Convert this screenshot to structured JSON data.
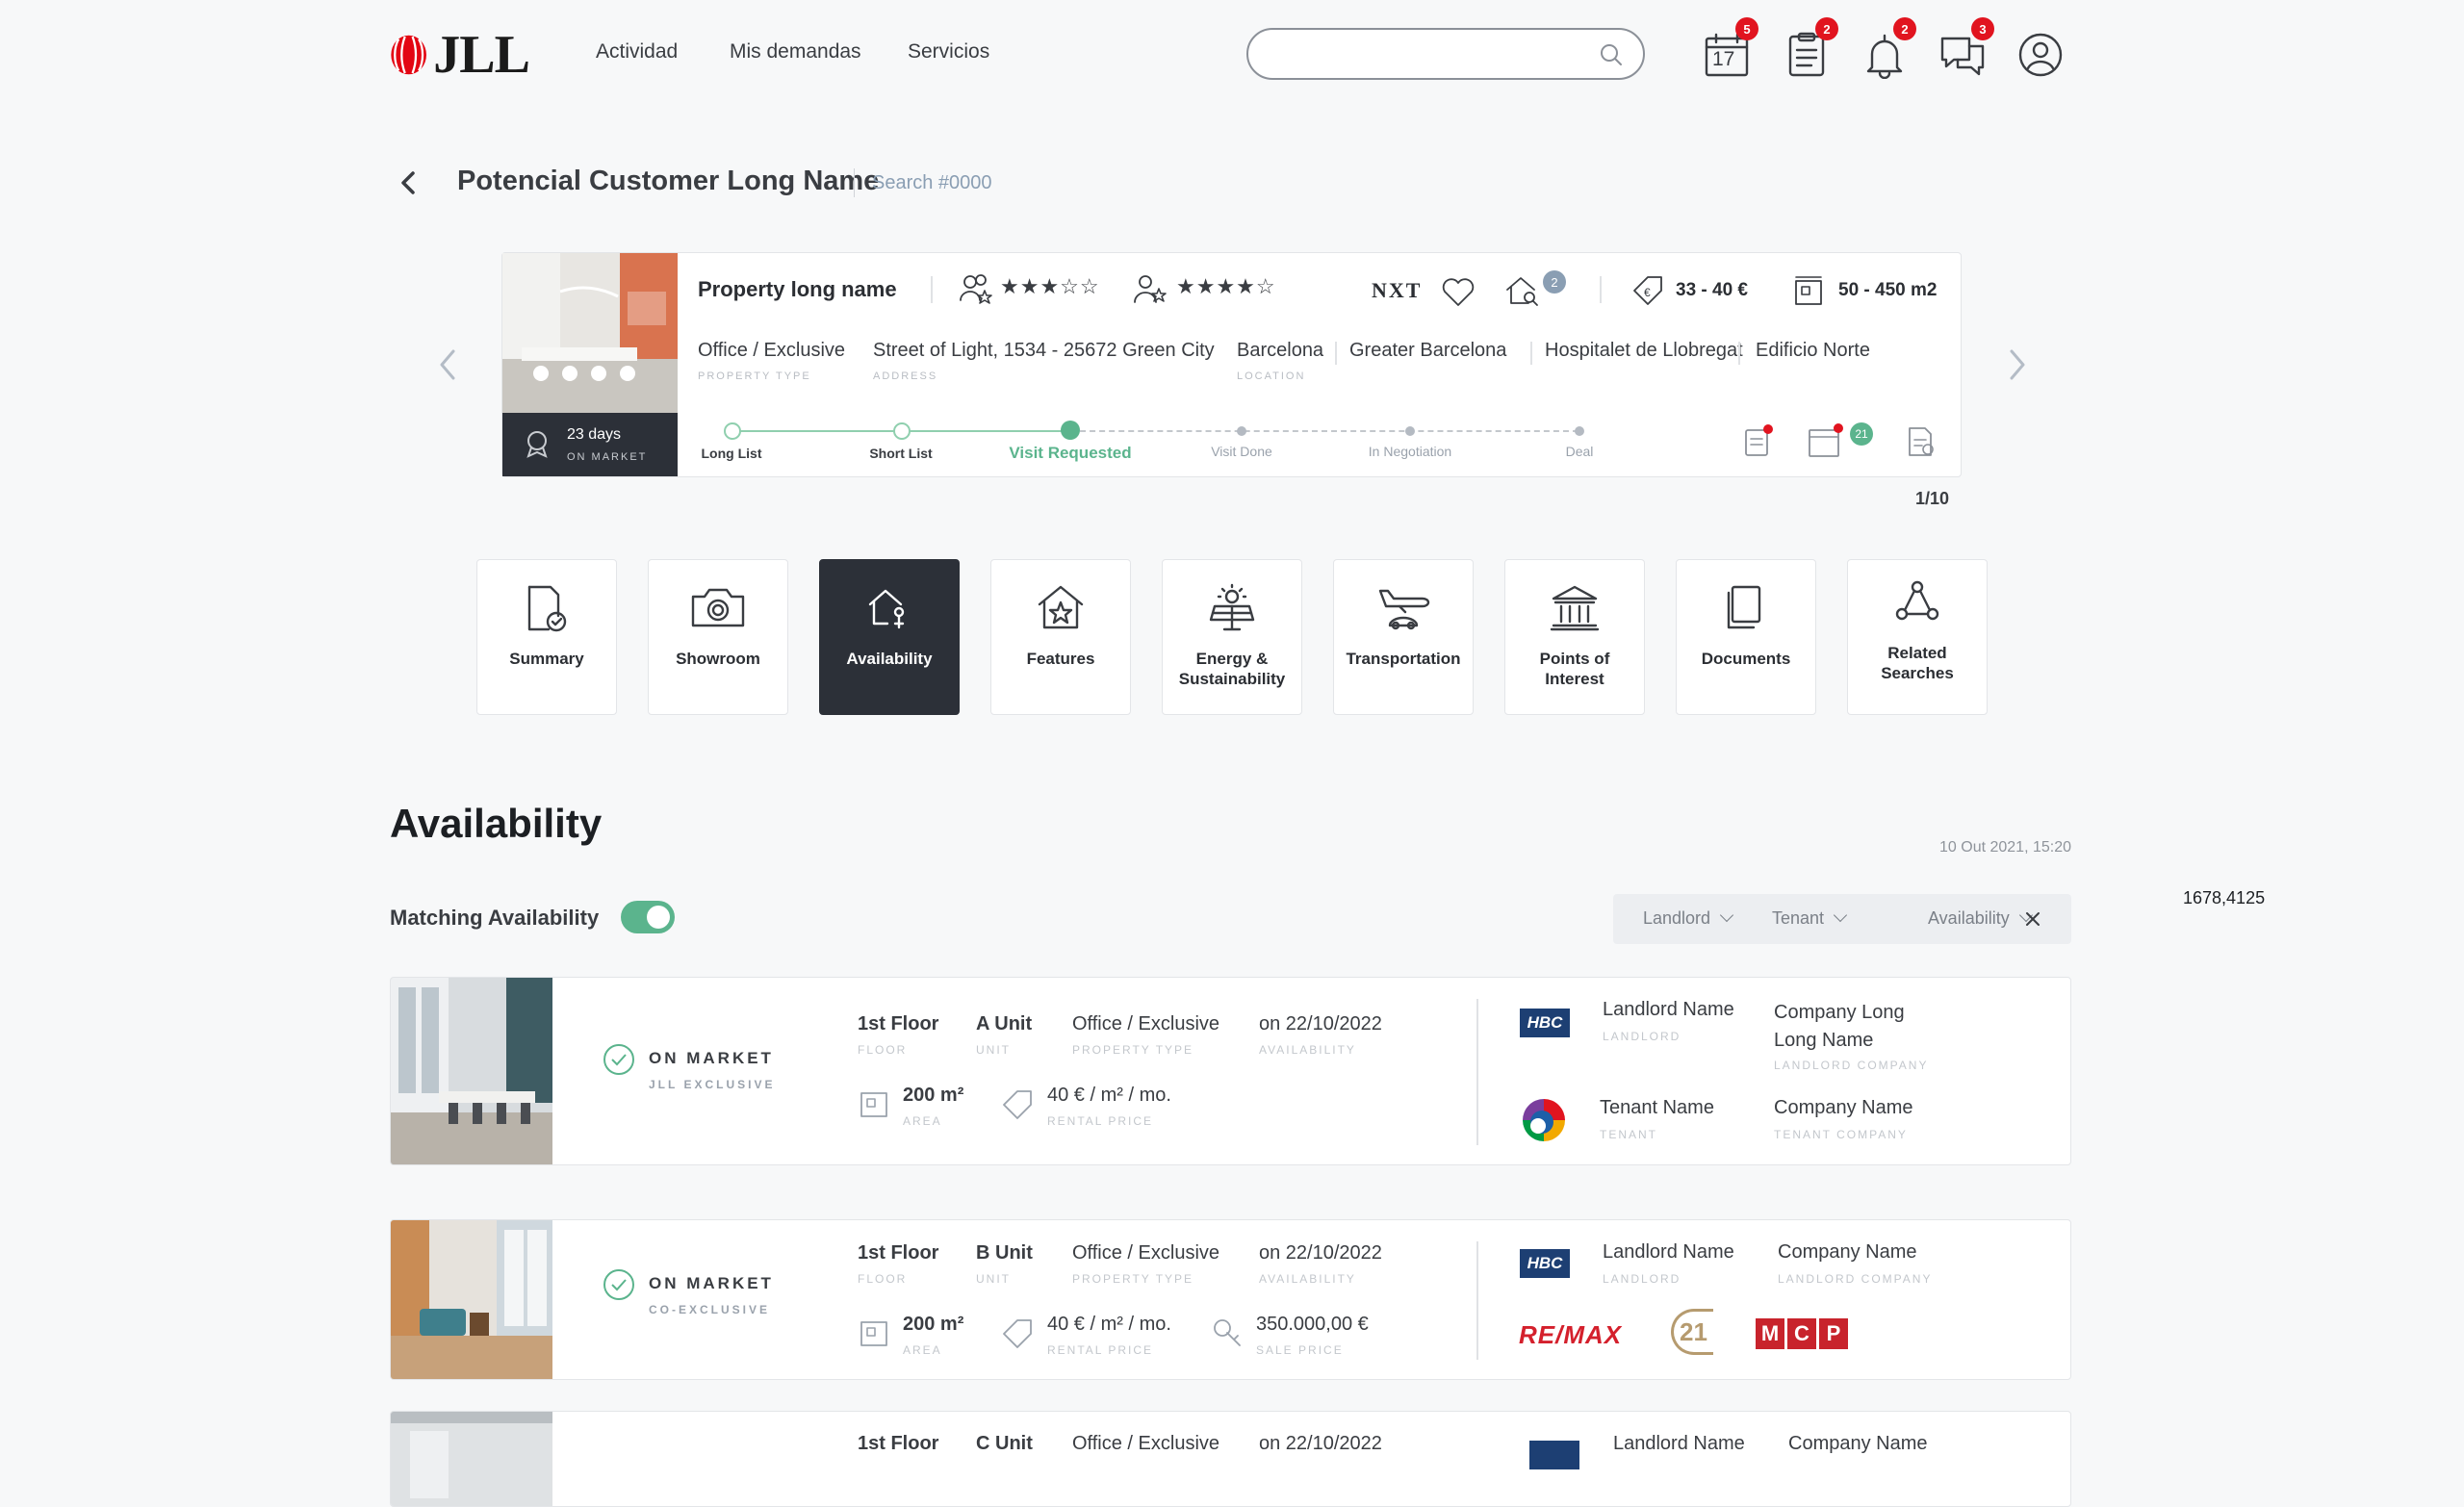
{
  "header": {
    "logo": "JLL",
    "nav": [
      "Actividad",
      "Mis demandas",
      "Servicios"
    ],
    "search_placeholder": "",
    "icons": [
      {
        "name": "calendar-icon",
        "badge": "5",
        "label": "17"
      },
      {
        "name": "clipboard-icon",
        "badge": "2"
      },
      {
        "name": "bell-icon",
        "badge": "2"
      },
      {
        "name": "chat-icon",
        "badge": "3"
      },
      {
        "name": "user-icon"
      }
    ]
  },
  "breadcrumb": {
    "customer": "Potencial Customer Long Name",
    "search_id": "Search #0000"
  },
  "property": {
    "name": "Property long name",
    "rating_1": "★★★☆☆",
    "rating_2": "★★★★☆",
    "brand": "NXT",
    "badge_count": "2",
    "price": "33 - 40 €",
    "area": "50 - 450 m2",
    "type": "Office / Exclusive",
    "type_label": "PROPERTY TYPE",
    "address": "Street of Light, 1534 - 25672 Green City",
    "address_label": "ADDRESS",
    "location": "Barcelona",
    "location_label": "LOCATION",
    "zones": [
      "Greater Barcelona",
      "Hospitalet de Llobregat",
      "Edificio Norte"
    ],
    "days": "23 days",
    "days_label": "ON MARKET",
    "steps": [
      "Long List",
      "Short List",
      "Visit Requested",
      "Visit Done",
      "In Negotiation",
      "Deal"
    ],
    "progress_step": 3,
    "calendar_count": "21",
    "pager": "1/10"
  },
  "tabs": [
    {
      "label": "Summary",
      "icon": "summary-icon"
    },
    {
      "label": "Showroom",
      "icon": "camera-icon"
    },
    {
      "label": "Availability",
      "icon": "availability-icon",
      "active": true
    },
    {
      "label": "Features",
      "icon": "features-icon"
    },
    {
      "label": "Energy & Sustainability",
      "icon": "energy-icon"
    },
    {
      "label": "Transportation",
      "icon": "transport-icon"
    },
    {
      "label": "Points of Interest",
      "icon": "landmark-icon"
    },
    {
      "label": "Documents",
      "icon": "documents-icon"
    },
    {
      "label": "Related Searches",
      "icon": "network-icon"
    }
  ],
  "availability": {
    "title": "Availability",
    "date": "10 Out 2021, 15:20",
    "matching_label": "Matching Availability",
    "matching_on": true,
    "filters": [
      "Landlord",
      "Tenant",
      "Availability"
    ],
    "coords": "1678,4125",
    "labels": {
      "floor": "FLOOR",
      "unit": "UNIT",
      "ptype": "PROPERTY TYPE",
      "availability": "AVAILABILITY",
      "area": "AREA",
      "rental": "RENTAL PRICE",
      "sale": "SALE PRICE",
      "landlord": "LANDLORD",
      "landlord_company": "LANDLORD COMPANY",
      "tenant": "TENANT",
      "tenant_company": "TENANT COMPANY"
    },
    "rows": [
      {
        "status": "ON MARKET",
        "sub": "JLL EXCLUSIVE",
        "floor": "1st Floor",
        "unit": "A Unit",
        "ptype": "Office / Exclusive",
        "avail": "on 22/10/2022",
        "area": "200 m²",
        "rent": "40 € / m² / mo.",
        "landlord_logo": "HBC",
        "landlord": "Landlord Name",
        "landlord_company": "Company Long Long Name",
        "tenant": "Tenant Name",
        "tenant_company": "Company Name"
      },
      {
        "status": "ON MARKET",
        "sub": "CO-EXCLUSIVE",
        "floor": "1st Floor",
        "unit": "B Unit",
        "ptype": "Office / Exclusive",
        "avail": "on 22/10/2022",
        "area": "200 m²",
        "rent": "40 € / m² / mo.",
        "sale": "350.000,00 €",
        "landlord_logo": "HBC",
        "landlord": "Landlord Name",
        "landlord_company": "Company Name",
        "agencies": [
          "RE/MAX",
          "21",
          "MCP"
        ]
      },
      {
        "floor": "1st Floor",
        "unit": "C Unit",
        "ptype": "Office / Exclusive",
        "avail": "on 22/10/2022",
        "landlord": "Landlord Name",
        "landlord_company": "Company Name"
      }
    ]
  }
}
